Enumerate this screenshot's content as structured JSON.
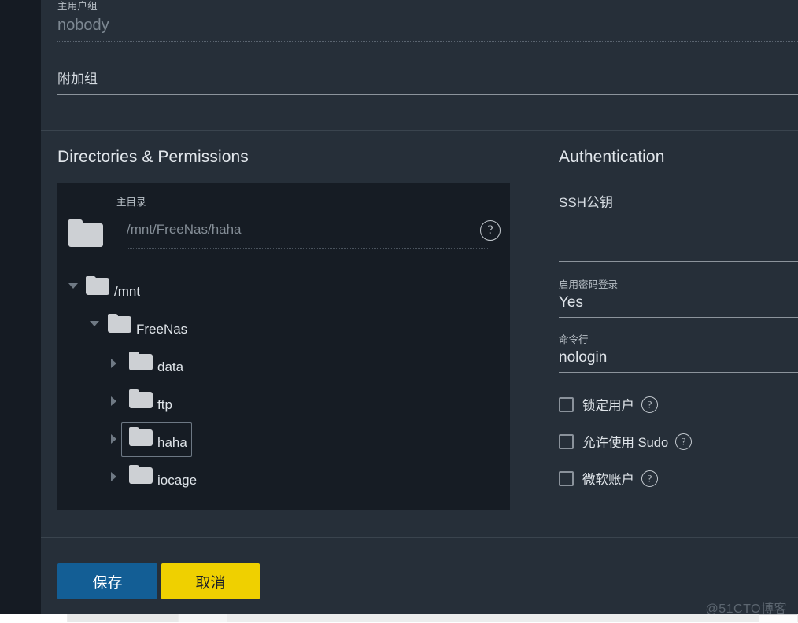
{
  "form": {
    "primary_group": {
      "label": "主用户组",
      "value": "nobody"
    },
    "aux_group": {
      "label": "附加组"
    }
  },
  "directories": {
    "heading": "Directories & Permissions",
    "home": {
      "label": "主目录",
      "value": "/mnt/FreeNas/haha",
      "folder_icon": "folder-icon",
      "help_icon": "help-circle-icon"
    },
    "tree": [
      {
        "label": "/mnt",
        "depth": 1,
        "caret": "caret-down-icon",
        "selected": false
      },
      {
        "label": "FreeNas",
        "depth": 2,
        "caret": "caret-down-icon",
        "selected": false
      },
      {
        "label": "data",
        "depth": 3,
        "caret": "caret-right-icon",
        "selected": false
      },
      {
        "label": "ftp",
        "depth": 3,
        "caret": "caret-right-icon",
        "selected": false
      },
      {
        "label": "haha",
        "depth": 3,
        "caret": "caret-right-icon",
        "selected": true
      },
      {
        "label": "iocage",
        "depth": 3,
        "caret": "caret-right-icon",
        "selected": false
      }
    ]
  },
  "authentication": {
    "heading": "Authentication",
    "ssh_key": {
      "label": "SSH公钥"
    },
    "password_login": {
      "label": "启用密码登录",
      "value": "Yes"
    },
    "shell": {
      "label": "命令行",
      "value": "nologin"
    },
    "checkboxes": [
      {
        "label": "锁定用户",
        "checked": false,
        "help_icon": "help-circle-icon"
      },
      {
        "label": "允许使用 Sudo",
        "checked": false,
        "help_icon": "help-circle-icon"
      },
      {
        "label": "微软账户",
        "checked": false,
        "help_icon": "help-circle-icon"
      }
    ]
  },
  "footer": {
    "save_label": "保存",
    "cancel_label": "取消"
  },
  "watermark": "@51CTO博客",
  "colors": {
    "page_bg": "#262f39",
    "rail_bg": "#151b23",
    "card_bg": "#161c24",
    "save_btn": "#135e95",
    "cancel_btn": "#efd000",
    "divider": "#3a444e",
    "label_text": "#b9c0c7",
    "value_text": "#dfe4e9",
    "muted_text": "#7d8892"
  }
}
